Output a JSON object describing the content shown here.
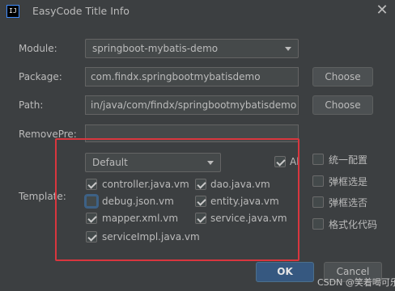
{
  "window": {
    "title": "EasyCode Title Info",
    "app_icon_text": "IJ",
    "close_glyph": "✕"
  },
  "form": {
    "module_label": "Module:",
    "module_value": "springboot-mybatis-demo",
    "package_label": "Package:",
    "package_value": "com.findx.springbootmybatisdemo",
    "path_label": "Path:",
    "path_value": "in/java/com/findx/springbootmybatisdemo",
    "remove_pre_label": "RemovePre:",
    "remove_pre_value": "",
    "choose_label": "Choose"
  },
  "template": {
    "label": "Template:",
    "group_value": "Default",
    "all_label": "All",
    "all_checked": true,
    "items": [
      {
        "label": "controller.java.vm",
        "checked": true
      },
      {
        "label": "dao.java.vm",
        "checked": true
      },
      {
        "label": "debug.json.vm",
        "checked": false
      },
      {
        "label": "entity.java.vm",
        "checked": true
      },
      {
        "label": "mapper.xml.vm",
        "checked": true
      },
      {
        "label": "service.java.vm",
        "checked": true
      },
      {
        "label": "serviceImpl.java.vm",
        "checked": true
      }
    ]
  },
  "options": [
    {
      "label": "统一配置",
      "checked": false
    },
    {
      "label": "弹框选是",
      "checked": false
    },
    {
      "label": "弹框选否",
      "checked": false
    },
    {
      "label": "格式化代码",
      "checked": false
    }
  ],
  "buttons": {
    "ok_label": "OK",
    "cancel_label": "Cancel"
  },
  "watermark": "CSDN @笑着喝可乐",
  "colors": {
    "background": "#3c3f41",
    "field_background": "#45494a",
    "primary_button": "#365880",
    "highlight_box": "#d9363e"
  }
}
